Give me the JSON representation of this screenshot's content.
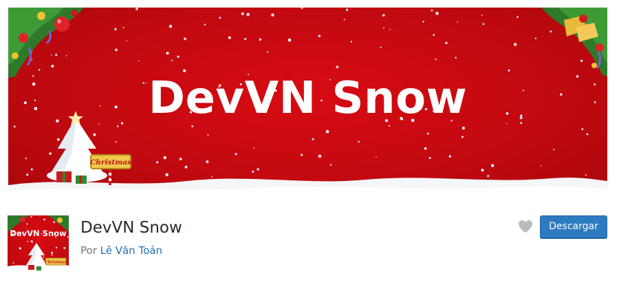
{
  "banner": {
    "title": "DevVN Snow",
    "sign_text": "Christmas"
  },
  "plugin": {
    "thumbnail_title": "DevVN Snow",
    "thumbnail_sign_text": "Christmas",
    "name": "DevVN Snow",
    "byline_prefix": "Por",
    "author": "Lê Văn Toản"
  },
  "actions": {
    "favorite_icon": "heart-icon",
    "download_label": "Descargar"
  },
  "colors": {
    "banner_red": "#c70a10",
    "button_blue": "#2d7ac0",
    "author_link": "#2271b1"
  }
}
